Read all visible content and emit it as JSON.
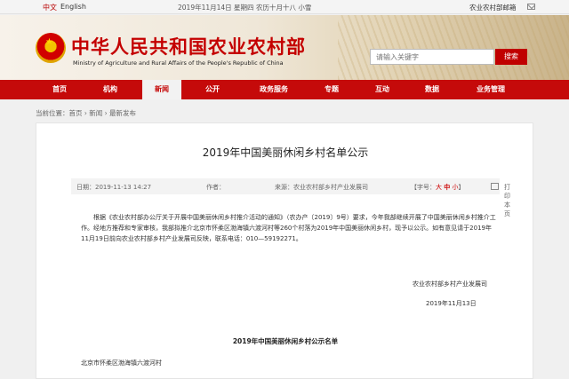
{
  "topbar": {
    "lang_cn": "中文",
    "lang_en": "English",
    "date_text": "2019年11月14日 星期四 农历十月十八 小雪",
    "mailbox": "农业农村部邮箱"
  },
  "header": {
    "title": "中华人民共和国农业农村部",
    "subtitle": "Ministry of Agriculture and Rural Affairs of the People's Republic of China",
    "search_placeholder": "请输入关键字",
    "search_button": "搜索"
  },
  "nav": {
    "items": [
      {
        "label": "首页"
      },
      {
        "label": "机构"
      },
      {
        "label": "新闻"
      },
      {
        "label": "公开"
      },
      {
        "label": "政务服务"
      },
      {
        "label": "专题"
      },
      {
        "label": "互动"
      },
      {
        "label": "数据"
      },
      {
        "label": "业务管理"
      }
    ],
    "active_index": 2
  },
  "breadcrumb": "当前位置：首页 › 新闻 › 最新发布",
  "article": {
    "title": "2019年中国美丽休闲乡村名单公示",
    "meta": {
      "date": "日期：2019-11-13 14:27",
      "author": "作者：",
      "source": "来源：农业农村部乡村产业发展司",
      "font_size_label": "【字号：",
      "font_big": "大",
      "font_mid": "中",
      "font_small": "小",
      "font_size_end": "】",
      "print": "打印本页"
    },
    "paragraph": "根据《农业农村部办公厅关于开展中国美丽休闲乡村推介活动的通知》（农办产〔2019〕9号）要求，今年我部继续开展了中国美丽休闲乡村推介工作。经地方推荐和专家审核，我部拟推介北京市怀柔区渤海镇六渡河村等260个村落为2019年中国美丽休闲乡村，现予以公示。如有意见请于2019年11月19日前向农业农村部乡村产业发展司反映，联系电话：010—59192271。",
    "sign_dept": "农业农村部乡村产业发展司",
    "sign_date": "2019年11月13日",
    "list_title": "2019年中国美丽休闲乡村公示名单",
    "list_first": "北京市怀柔区渤海镇六渡河村"
  },
  "colors": {
    "brand_red": "#c50a0a",
    "title_red": "#c40000"
  }
}
